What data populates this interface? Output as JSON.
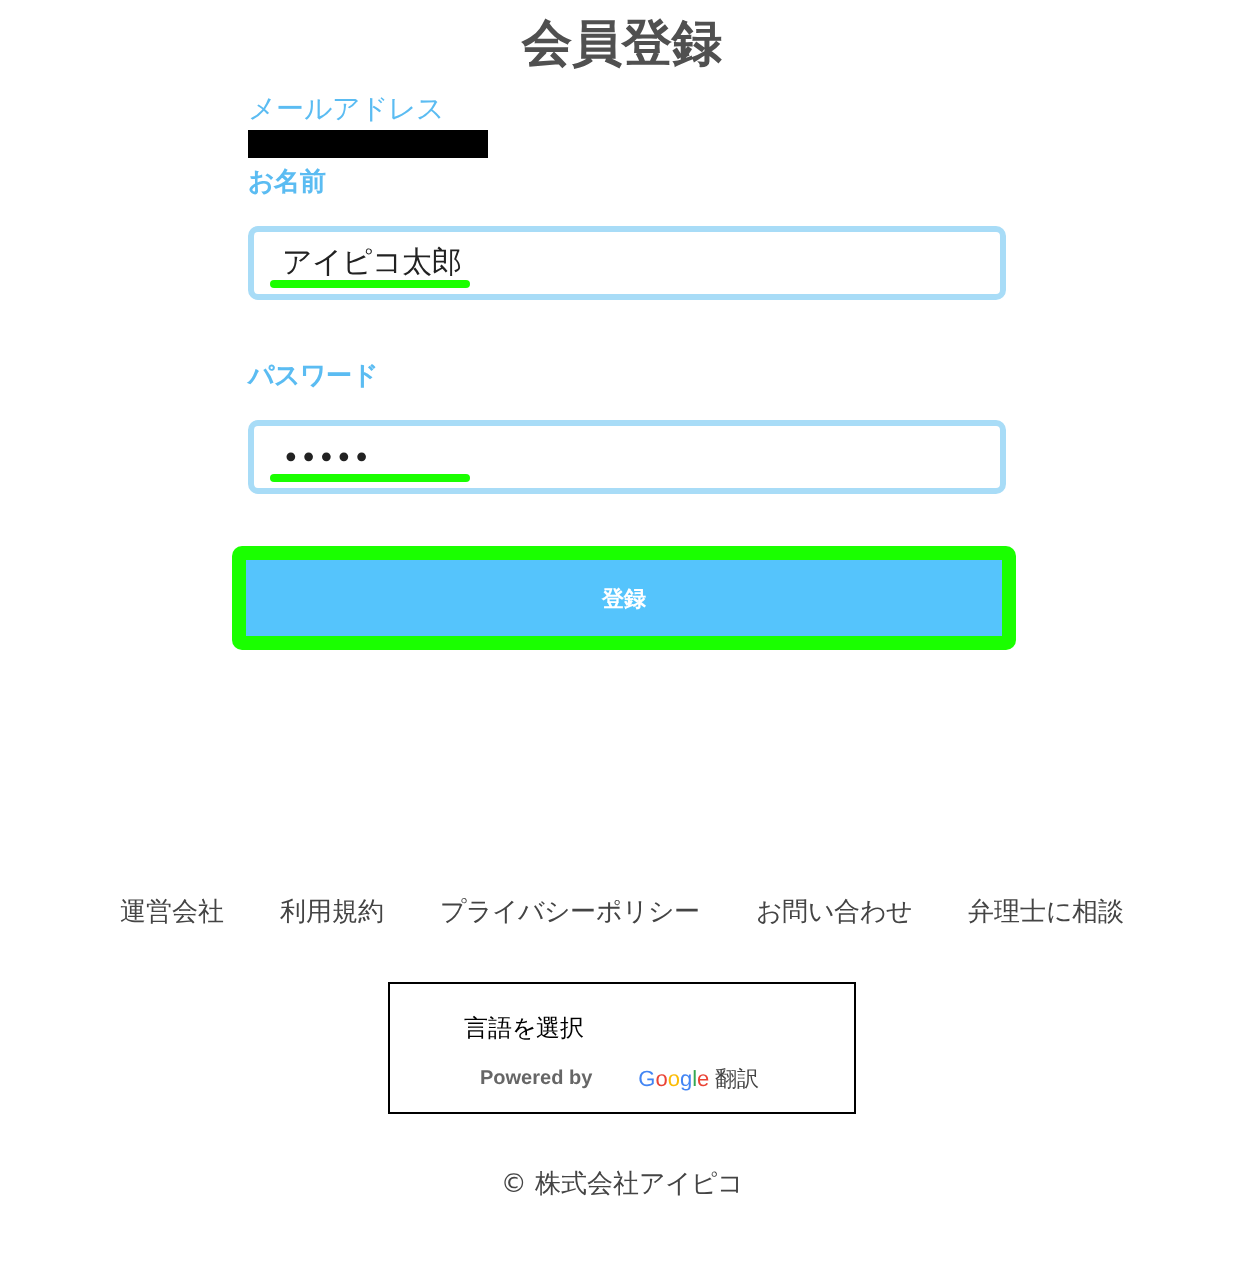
{
  "title": "会員登録",
  "email": {
    "label": "メールアドレス",
    "redacted": true
  },
  "fields": [
    {
      "label": "お名前",
      "value": "アイピコ太郎",
      "highlighted": true
    },
    {
      "label": "パスワード",
      "value": "•••••",
      "highlighted": true
    }
  ],
  "submit": {
    "label": "登録",
    "highlighted": true
  },
  "footer_links": [
    "運営会社",
    "利用規約",
    "プライバシーポリシー",
    "お問い合わせ",
    "弁理士に相談"
  ],
  "translate": {
    "label": "言語を選択",
    "powered_by": "Powered by",
    "brand": "Google",
    "service": "翻訳"
  },
  "copyright": "© 株式会社アイピコ"
}
